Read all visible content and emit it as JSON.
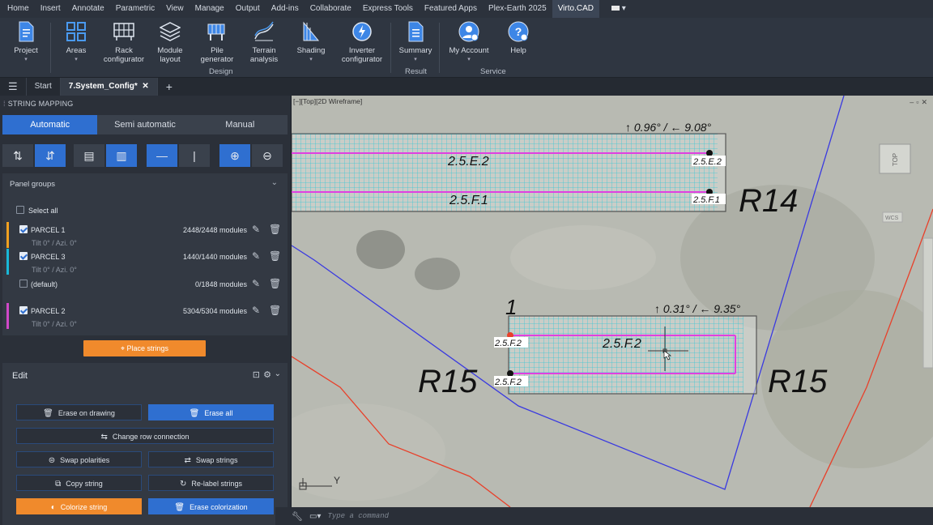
{
  "menubar": {
    "items": [
      "Home",
      "Insert",
      "Annotate",
      "Parametric",
      "View",
      "Manage",
      "Output",
      "Add-ins",
      "Collaborate",
      "Express Tools",
      "Featured Apps",
      "Plex-Earth 2025",
      "Virto.CAD"
    ],
    "active": "Virto.CAD"
  },
  "ribbon": {
    "buttons": {
      "project": {
        "line1": "Project",
        "line2": ""
      },
      "areas": {
        "line1": "Areas",
        "line2": ""
      },
      "rack": {
        "line1": "Rack",
        "line2": "configurator"
      },
      "module": {
        "line1": "Module",
        "line2": "layout"
      },
      "pile": {
        "line1": "Pile",
        "line2": "generator"
      },
      "terrain": {
        "line1": "Terrain",
        "line2": "analysis"
      },
      "shading": {
        "line1": "Shading",
        "line2": ""
      },
      "inverter": {
        "line1": "Inverter",
        "line2": "configurator"
      },
      "summary": {
        "line1": "Summary",
        "line2": ""
      },
      "account": {
        "line1": "My Account",
        "line2": ""
      },
      "help": {
        "line1": "Help",
        "line2": ""
      }
    },
    "groups": {
      "design": "Design",
      "result": "Result",
      "service": "Service"
    }
  },
  "tabs": {
    "start": "Start",
    "active": "7.System_Config*",
    "close": "✕",
    "add": "+"
  },
  "panel": {
    "title": "STRING MAPPING",
    "modes": [
      "Automatic",
      "Semi automatic",
      "Manual"
    ],
    "panel_groups_title": "Panel groups",
    "select_all": "Select all",
    "groups": [
      {
        "name": "PARCEL 1",
        "sub": "Tilt 0° / Azi. 0°",
        "modules": "2448/2448 modules",
        "checked": true,
        "color": "#f0a020"
      },
      {
        "name": "PARCEL 3",
        "sub": "Tilt 0° / Azi. 0°",
        "modules": "1440/1440 modules",
        "checked": true,
        "color": "#19b8d8"
      },
      {
        "name": "(default)",
        "sub": "",
        "modules": "0/1848 modules",
        "checked": false,
        "color": ""
      },
      {
        "name": "PARCEL 2",
        "sub": "Tilt 0° / Azi. 0°",
        "modules": "5304/5304 modules",
        "checked": true,
        "color": "#d048c8"
      }
    ],
    "place_strings": "Place strings",
    "edit_title": "Edit",
    "edit_buttons": {
      "erase_drawing": "Erase on drawing",
      "erase_all": "Erase all",
      "change_row": "Change row connection",
      "swap_polarities": "Swap polarities",
      "swap_strings": "Swap strings",
      "copy_string": "Copy string",
      "relabel": "Re-label strings",
      "colorize": "Colorize string",
      "erase_colorization": "Erase colorization"
    }
  },
  "viewport": {
    "label": "[−][Top][2D Wireframe]",
    "rows": {
      "r14": "R14",
      "r15a": "R15",
      "r15b": "R15",
      "one": "1",
      "angle1": "↑ 0.96° / ← 9.08°",
      "angle2": "↑ 0.31° / ← 9.35°",
      "e2": "2.5.E.2",
      "f1": "2.5.F.1",
      "f2": "2.5.F.2",
      "tag_e2": "2.5.E.2",
      "tag_f1": "2.5.F.1",
      "tag_f2a": "2.5.F.2",
      "tag_f2b": "2.5.F.2"
    },
    "viewcube": "TOP",
    "wcs": "WCS",
    "axis_y": "Y"
  },
  "command": {
    "placeholder": "Type a command"
  },
  "colors": {
    "accent": "#2f6fd0",
    "orange": "#f08a2c",
    "magenta": "#e040e0",
    "cyan": "#35c8d8",
    "blue_line": "#3a3ae0",
    "red_line": "#e8402a"
  }
}
